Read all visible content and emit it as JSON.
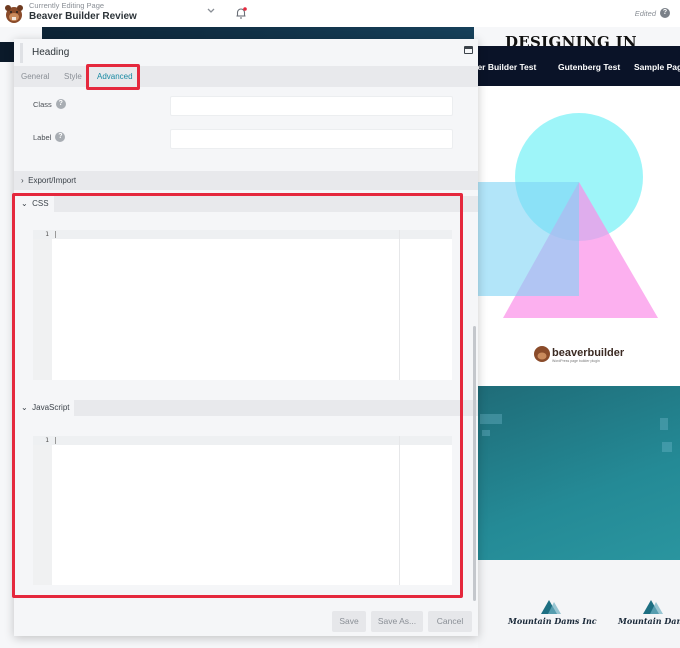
{
  "topbar": {
    "subtitle": "Currently Editing Page",
    "title": "Beaver Builder Review",
    "status": "Edited",
    "help_glyph": "?",
    "dropdown_glyph": "⌄",
    "icons": [
      "beaver-logo-icon",
      "chevron-down-icon",
      "bell-icon",
      "help-icon"
    ],
    "notification_dot_color": "#e5283d"
  },
  "preview": {
    "heading": "DESIGNING IN",
    "nav": [
      "Beaver Builder Test",
      "Gutenberg Test",
      "Sample Page"
    ],
    "nav_visible": [
      "aver Builder Test",
      "Gutenberg Test",
      "Sample Page"
    ],
    "brand_logo_text": "beaverbuilder",
    "brand_logo_tagline": "WordPress page builder plugin",
    "clients": [
      "Mountain Dams Inc",
      "Mountain Dams"
    ]
  },
  "panel": {
    "title": "Heading",
    "tabs": [
      {
        "label": "General",
        "active": false
      },
      {
        "label": "Style",
        "active": false
      },
      {
        "label": "Advanced",
        "active": true
      }
    ],
    "fields": [
      {
        "label": "Class",
        "value": "",
        "help": "?"
      },
      {
        "label": "Label",
        "value": "",
        "help": "?"
      }
    ],
    "sections": {
      "export_import": {
        "label": "Export/Import",
        "expanded": false,
        "glyph": "›"
      },
      "css": {
        "label": "CSS",
        "expanded": true,
        "glyph": "⌄",
        "line_number": "1",
        "content": ""
      },
      "javascript": {
        "label": "JavaScript",
        "expanded": true,
        "glyph": "⌄",
        "line_number": "1",
        "content": ""
      }
    },
    "buttons": {
      "save": "Save",
      "save_as": "Save As...",
      "cancel": "Cancel"
    }
  },
  "colors": {
    "accent": "#1a8aa3",
    "highlight": "#e5283d",
    "navbar": "#0a1328",
    "teal_section": "#248a96"
  }
}
